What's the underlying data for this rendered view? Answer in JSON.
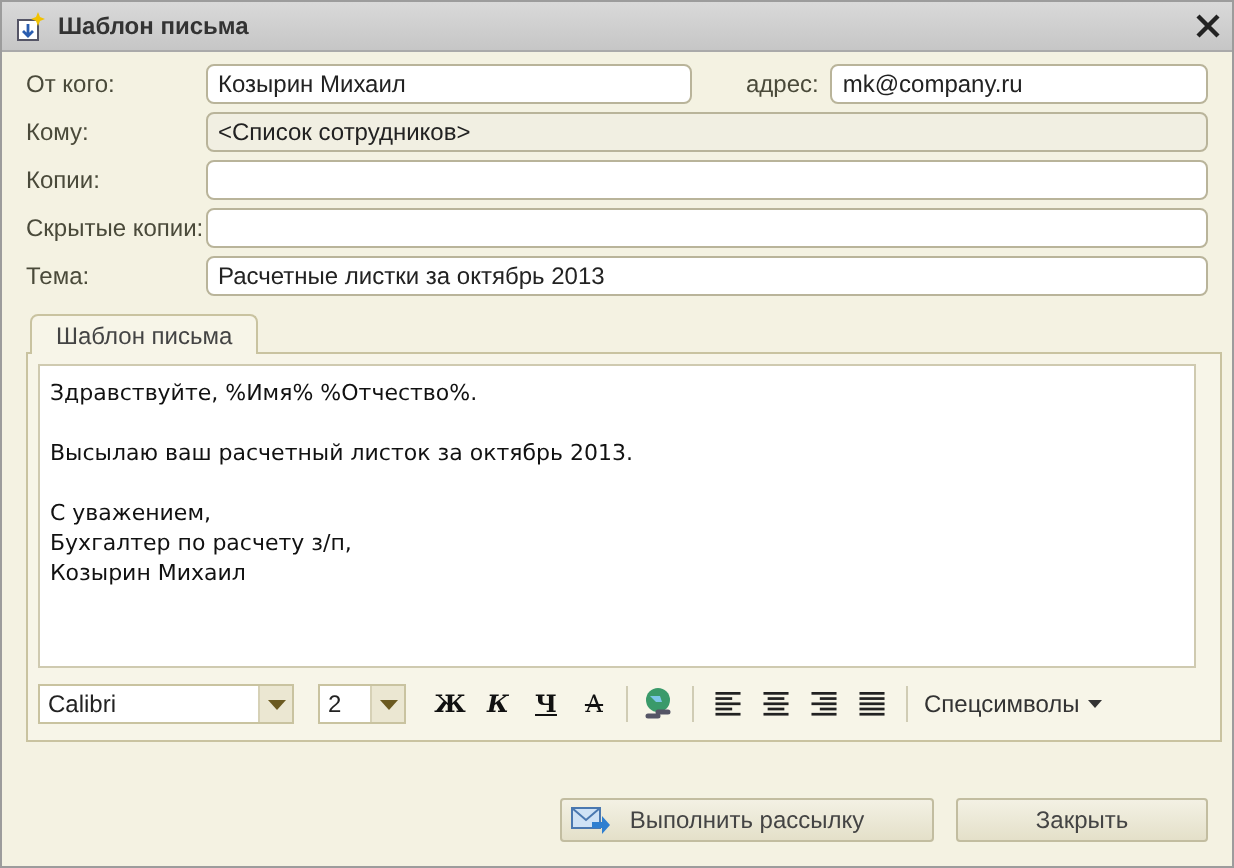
{
  "window": {
    "title": "Шаблон письма"
  },
  "fields": [
    {
      "label": "От кого:",
      "value": "Козырин Михаил",
      "disabled": false,
      "extra": {
        "label": "адрес:",
        "value": "mk@company.ru"
      }
    },
    {
      "label": "Кому:",
      "value": "<Список сотрудников>",
      "disabled": true
    },
    {
      "label": "Копии:",
      "disabled": false
    },
    {
      "label": "Скрытые копии:",
      "disabled": false
    },
    {
      "label": "Тема:",
      "value": "Расчетные листки за октябрь 2013",
      "disabled": false
    }
  ],
  "tabs": [
    {
      "label": "Шаблон письма",
      "selected": true
    }
  ],
  "editor": {
    "paragraphs": [
      [
        "Здравствуйте, %Имя% %Отчество%."
      ],
      [
        "Высылаю ваш расчетный листок за октябрь 2013."
      ],
      [
        "С уважением,",
        "Бухгалтер по расчету з/п,",
        "Козырин Михаил"
      ]
    ]
  },
  "toolbar": {
    "font": "Calibri",
    "size": "2",
    "format_buttons": [
      {
        "label": "Ж",
        "kind": "bold"
      },
      {
        "label": "К",
        "kind": "italic"
      },
      {
        "label": "Ч",
        "kind": "underline"
      },
      {
        "label": "А",
        "kind": "strike"
      }
    ],
    "special": "Спецсимволы"
  },
  "buttons": [
    {
      "label": "Выполнить рассылку",
      "kind": "send"
    },
    {
      "label": "Закрыть",
      "kind": "plain"
    }
  ]
}
